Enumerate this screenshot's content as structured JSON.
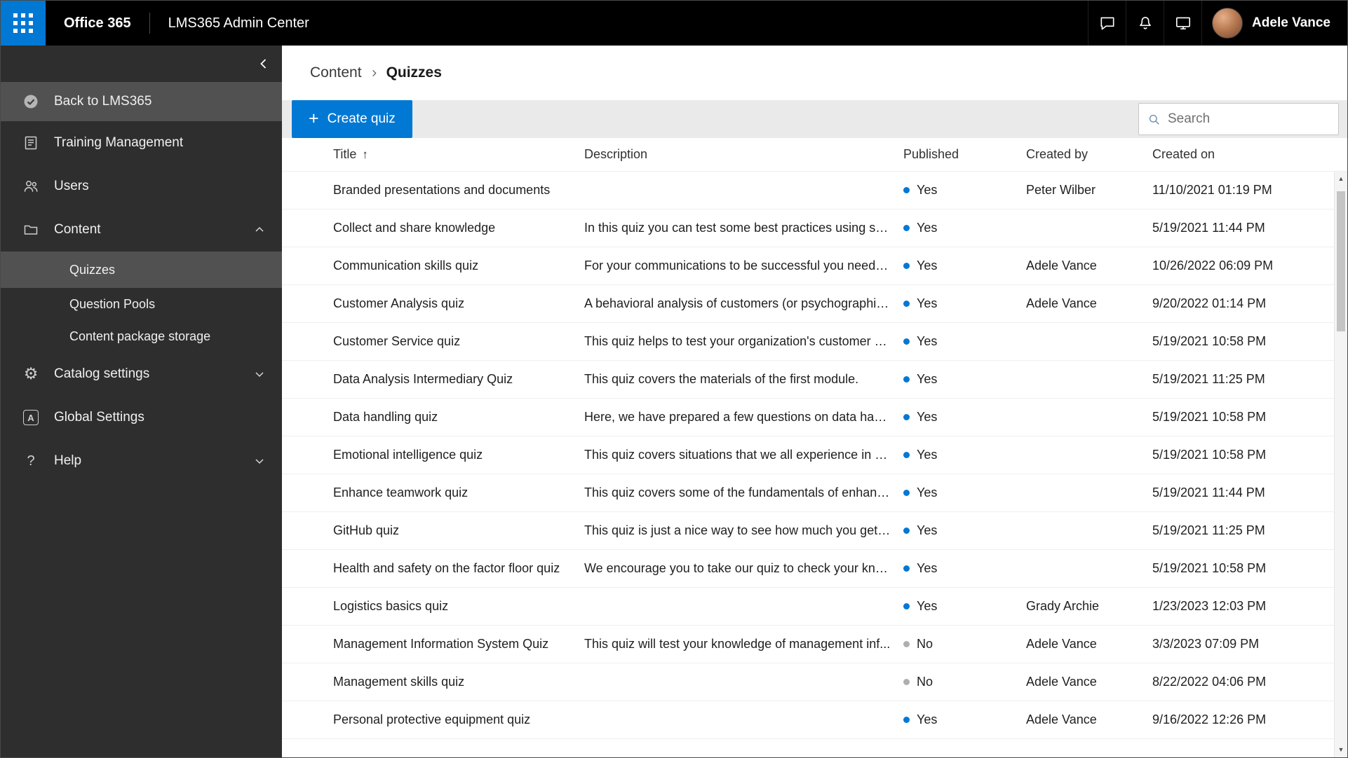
{
  "topbar": {
    "brand": "Office 365",
    "app_title": "LMS365 Admin Center",
    "user_name": "Adele Vance"
  },
  "sidebar": {
    "back": "Back to LMS365",
    "training": "Training Management",
    "users": "Users",
    "content": "Content",
    "quizzes": "Quizzes",
    "question_pools": "Question Pools",
    "package_storage": "Content package storage",
    "catalog": "Catalog settings",
    "global": "Global Settings",
    "help": "Help"
  },
  "breadcrumb": {
    "parent": "Content",
    "current": "Quizzes"
  },
  "toolbar": {
    "create_quiz": "Create quiz",
    "search_placeholder": "Search"
  },
  "icons": {
    "plus": "+",
    "sort_asc": "↑",
    "scroll_up": "▲",
    "scroll_down": "▼"
  },
  "table": {
    "columns": [
      "Title",
      "Description",
      "Published",
      "Created by",
      "Created on"
    ],
    "rows": [
      {
        "title": "Branded presentations and documents",
        "description": "",
        "published": "Yes",
        "created_by": "Peter Wilber",
        "created_on": "11/10/2021 01:19 PM"
      },
      {
        "title": "Collect and share knowledge",
        "description": "In this quiz you can test some best practices using so...",
        "published": "Yes",
        "created_by": "",
        "created_on": "5/19/2021 11:44 PM"
      },
      {
        "title": "Communication skills quiz",
        "description": "For your communications to be successful you need t...",
        "published": "Yes",
        "created_by": "Adele Vance",
        "created_on": "10/26/2022 06:09 PM"
      },
      {
        "title": "Customer Analysis quiz",
        "description": "A behavioral analysis of customers (or psychographic ...",
        "published": "Yes",
        "created_by": "Adele Vance",
        "created_on": "9/20/2022 01:14 PM"
      },
      {
        "title": "Customer Service quiz",
        "description": "This quiz helps to test your organization's customer s...",
        "published": "Yes",
        "created_by": "",
        "created_on": "5/19/2021 10:58 PM"
      },
      {
        "title": "Data Analysis Intermediary Quiz",
        "description": "This quiz covers the materials of the first module.",
        "published": "Yes",
        "created_by": "",
        "created_on": "5/19/2021 11:25 PM"
      },
      {
        "title": "Data handling quiz",
        "description": "Here, we have prepared a few questions on data hand...",
        "published": "Yes",
        "created_by": "",
        "created_on": "5/19/2021 10:58 PM"
      },
      {
        "title": "Emotional intelligence quiz",
        "description": "This quiz covers situations that we all experience in ou...",
        "published": "Yes",
        "created_by": "",
        "created_on": "5/19/2021 10:58 PM"
      },
      {
        "title": "Enhance teamwork quiz",
        "description": "This quiz covers some of the fundamentals of enhanci...",
        "published": "Yes",
        "created_by": "",
        "created_on": "5/19/2021 11:44 PM"
      },
      {
        "title": "GitHub quiz",
        "description": "This quiz is just a nice way to see how much you get f...",
        "published": "Yes",
        "created_by": "",
        "created_on": "5/19/2021 11:25 PM"
      },
      {
        "title": "Health and safety on the factor floor quiz",
        "description": "We encourage you to take our quiz to check your kno...",
        "published": "Yes",
        "created_by": "",
        "created_on": "5/19/2021 10:58 PM"
      },
      {
        "title": "Logistics basics quiz",
        "description": "",
        "published": "Yes",
        "created_by": "Grady Archie",
        "created_on": "1/23/2023 12:03 PM"
      },
      {
        "title": "Management Information System Quiz",
        "description": "This quiz will test your knowledge of management inf...",
        "published": "No",
        "created_by": "Adele Vance",
        "created_on": "3/3/2023 07:09 PM"
      },
      {
        "title": "Management skills quiz",
        "description": "",
        "published": "No",
        "created_by": "Adele Vance",
        "created_on": "8/22/2022 04:06 PM"
      },
      {
        "title": "Personal protective equipment quiz",
        "description": "",
        "published": "Yes",
        "created_by": "Adele Vance",
        "created_on": "9/16/2022 12:26 PM"
      }
    ]
  },
  "colors": {
    "accent": "#0078d4",
    "topbar_bg": "#000000",
    "sidebar_bg": "#2e2e2e",
    "sidebar_selected": "#515151",
    "toolbar_bg": "#eaeaea",
    "published_yes": "#0078d4",
    "published_no": "#b1afad"
  }
}
